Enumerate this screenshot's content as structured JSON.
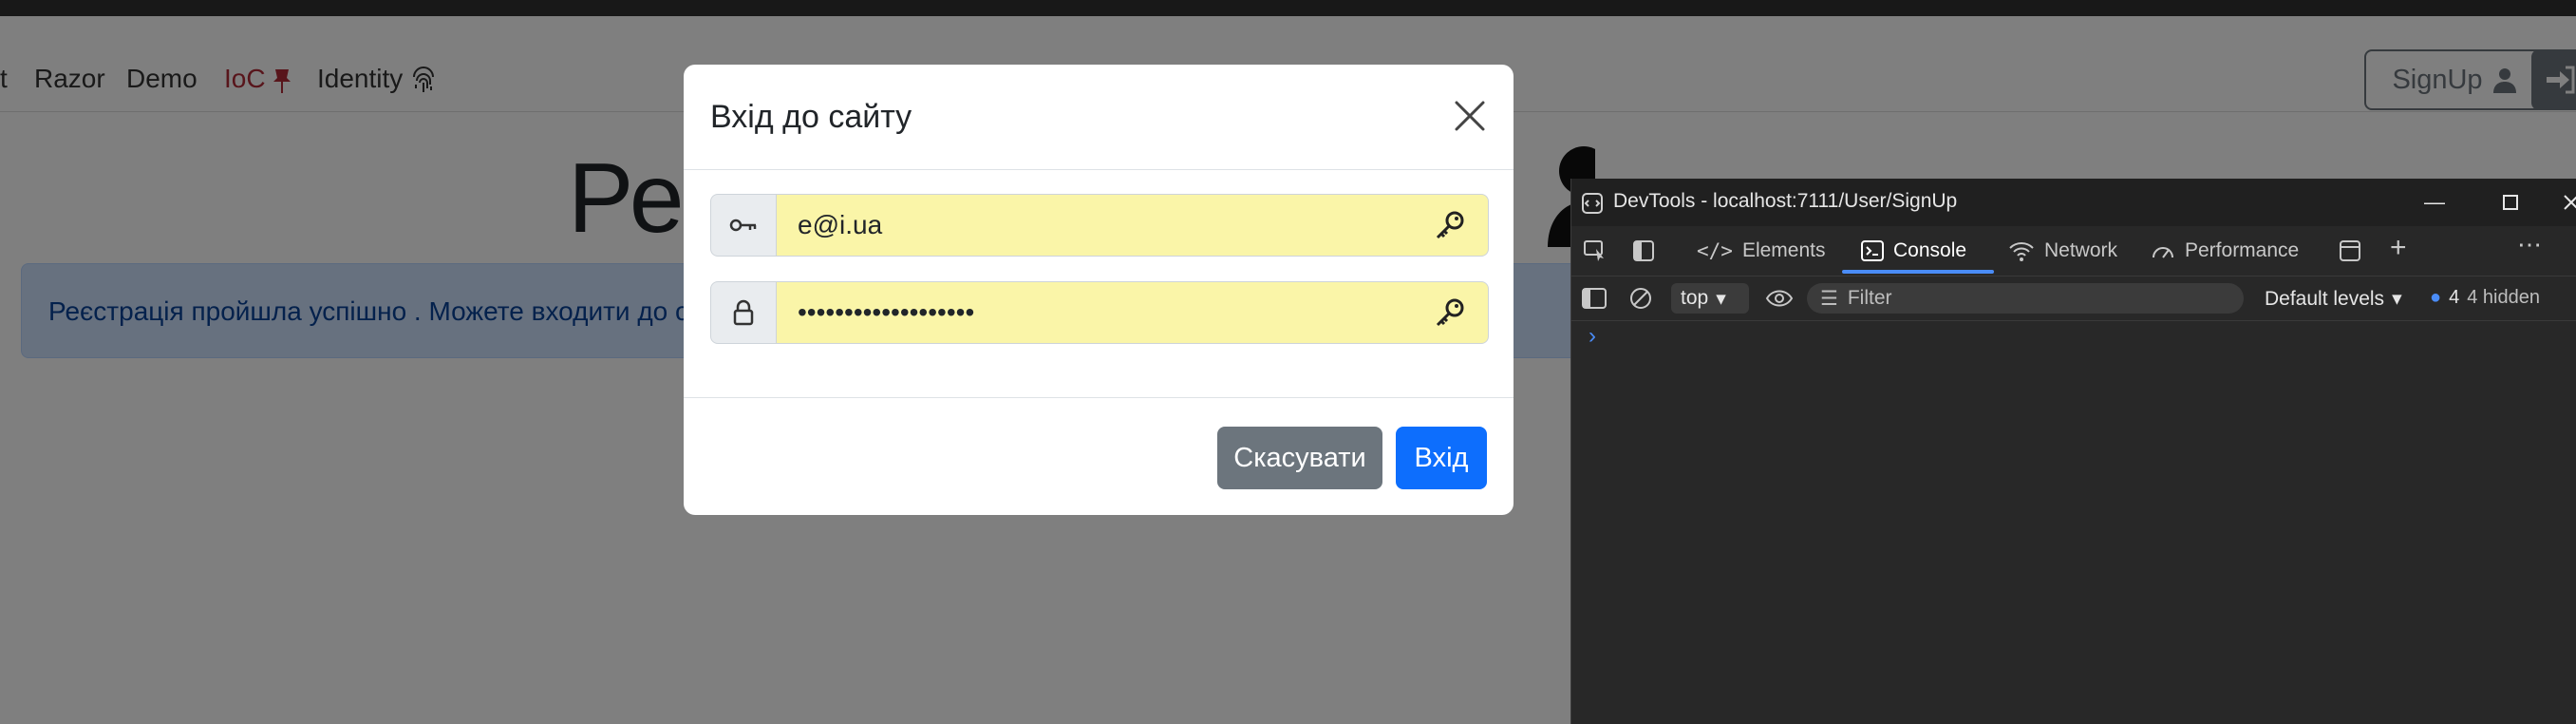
{
  "nav": {
    "items": [
      "t",
      "Razor",
      "Demo",
      "IoC",
      "Identity"
    ],
    "signup_label": "SignUp"
  },
  "page": {
    "heading_visible": "Рее",
    "alert_text": "Реєстрація пройшла успішно . Можете входити до с"
  },
  "modal": {
    "title": "Вхід до сайту",
    "email_value": "e@i.ua",
    "password_value": "•••••••••••••••••••",
    "cancel_label": "Скасувати",
    "login_label": "Вхід"
  },
  "devtools": {
    "title": "DevTools - localhost:7111/User/SignUp",
    "tabs": [
      "Elements",
      "Console",
      "Network",
      "Performance"
    ],
    "context": "top",
    "filter_placeholder": "Filter",
    "levels": "Default levels",
    "issues_count": "4",
    "hidden": "4 hidden"
  },
  "colors": {
    "primary": "#0d6efd",
    "secondary": "#6c757d",
    "ioc_red": "#b02a37",
    "autofill_yellow": "#faf5a8",
    "devtools_bg": "#282828"
  }
}
